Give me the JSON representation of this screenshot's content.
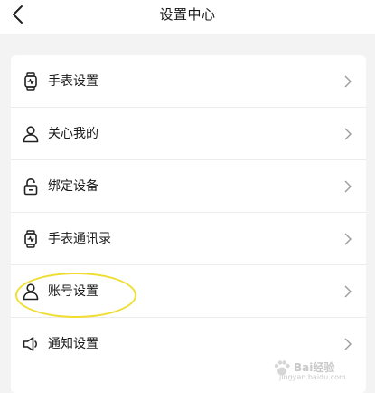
{
  "header": {
    "title": "设置中心"
  },
  "menu": {
    "items": [
      {
        "label": "手表设置",
        "icon": "watch-icon"
      },
      {
        "label": "关心我的",
        "icon": "user-icon"
      },
      {
        "label": "绑定设备",
        "icon": "lock-icon"
      },
      {
        "label": "手表通讯录",
        "icon": "watch-icon"
      },
      {
        "label": "账号设置",
        "icon": "user-icon"
      },
      {
        "label": "通知设置",
        "icon": "speaker-icon"
      }
    ]
  },
  "watermark": {
    "brand": "Bai经验",
    "url": "jingyan.baidu.com"
  },
  "colors": {
    "highlight": "#f0dd32",
    "background": "#f3f3f3"
  }
}
